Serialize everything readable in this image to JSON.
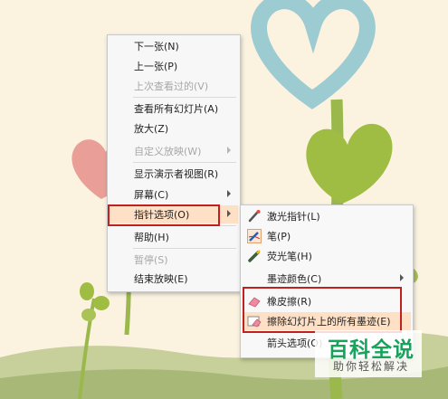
{
  "main_menu": {
    "items": [
      {
        "label": "下一张(N)",
        "disabled": false
      },
      {
        "label": "上一张(P)",
        "disabled": false
      },
      {
        "label": "上次查看过的(V)",
        "disabled": true
      },
      {
        "label": "查看所有幻灯片(A)",
        "disabled": false
      },
      {
        "label": "放大(Z)",
        "disabled": false
      },
      {
        "label": "自定义放映(W)",
        "disabled": true
      },
      {
        "label": "显示演示者视图(R)",
        "disabled": false
      },
      {
        "label": "屏幕(C)",
        "disabled": false
      },
      {
        "label": "指针选项(O)",
        "disabled": false
      },
      {
        "label": "帮助(H)",
        "disabled": false
      },
      {
        "label": "暂停(S)",
        "disabled": true
      },
      {
        "label": "结束放映(E)",
        "disabled": false
      }
    ]
  },
  "sub_menu": {
    "items": [
      {
        "label": "激光指针(L)",
        "icon": "laser-pointer-icon"
      },
      {
        "label": "笔(P)",
        "icon": "pen-icon"
      },
      {
        "label": "荧光笔(H)",
        "icon": "highlighter-icon"
      },
      {
        "label": "墨迹颜色(C)",
        "icon": ""
      },
      {
        "label": "橡皮擦(R)",
        "icon": "eraser-icon"
      },
      {
        "label": "擦除幻灯片上的所有墨迹(E)",
        "icon": "erase-all-icon"
      },
      {
        "label": "箭头选项(O)",
        "icon": ""
      }
    ]
  },
  "watermark": {
    "title": "百科全说",
    "subtitle": "助你轻松解决"
  },
  "colors": {
    "highlight": "#fde0c6",
    "annotation_red": "#c0201e",
    "watermark_green": "#17a45a"
  }
}
